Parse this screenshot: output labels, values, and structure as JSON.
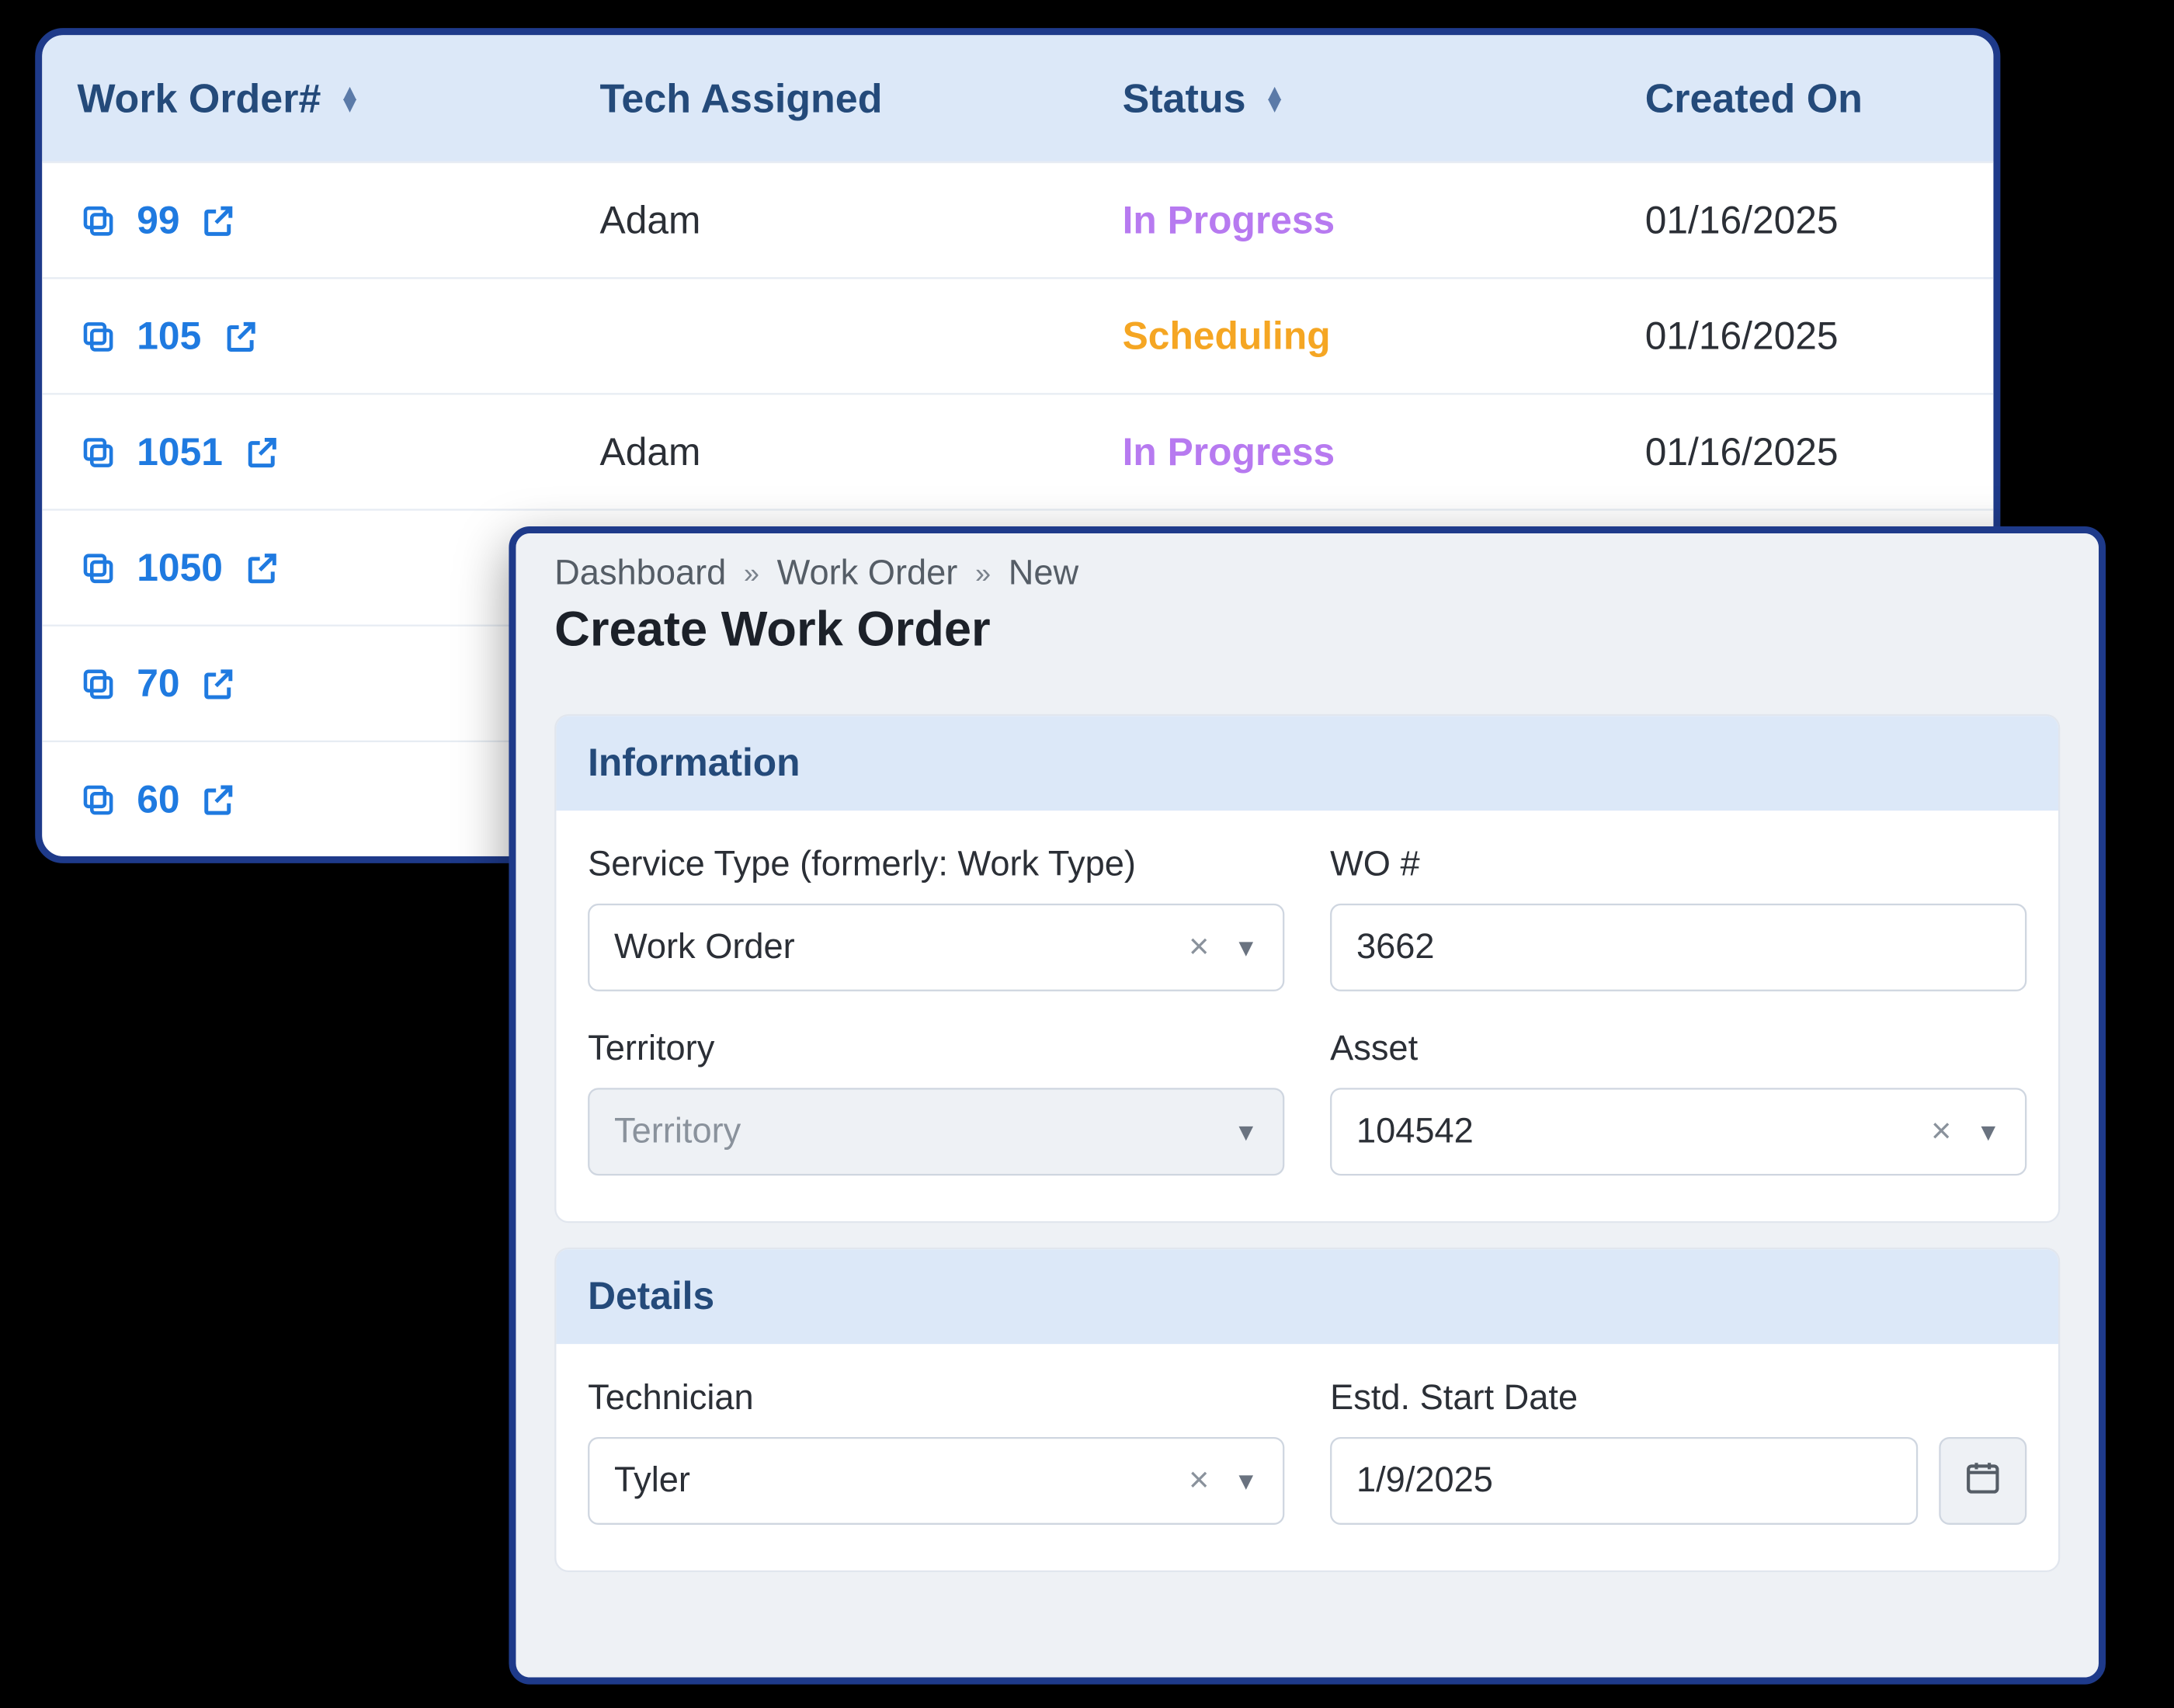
{
  "table": {
    "headers": {
      "work_order": "Work Order#",
      "tech": "Tech Assigned",
      "status": "Status",
      "created": "Created On"
    },
    "rows": [
      {
        "wo": "99",
        "tech": "Adam",
        "status": "In Progress",
        "status_kind": "inprogress",
        "created": "01/16/2025"
      },
      {
        "wo": "105",
        "tech": "",
        "status": "Scheduling",
        "status_kind": "scheduling",
        "created": "01/16/2025"
      },
      {
        "wo": "1051",
        "tech": "Adam",
        "status": "In Progress",
        "status_kind": "inprogress",
        "created": "01/16/2025"
      },
      {
        "wo": "1050",
        "tech": "",
        "status": "",
        "status_kind": "",
        "created": ""
      },
      {
        "wo": "70",
        "tech": "",
        "status": "",
        "status_kind": "",
        "created": ""
      },
      {
        "wo": "60",
        "tech": "",
        "status": "",
        "status_kind": "",
        "created": ""
      }
    ]
  },
  "form": {
    "breadcrumb": [
      "Dashboard",
      "Work Order",
      "New"
    ],
    "title": "Create Work Order",
    "sections": {
      "information": {
        "heading": "Information",
        "service_type_label": "Service Type (formerly: Work Type)",
        "service_type_value": "Work Order",
        "wo_number_label": "WO #",
        "wo_number_value": "3662",
        "territory_label": "Territory",
        "territory_placeholder": "Territory",
        "asset_label": "Asset",
        "asset_value": "104542"
      },
      "details": {
        "heading": "Details",
        "technician_label": "Technician",
        "technician_value": "Tyler",
        "estd_start_label": "Estd. Start Date",
        "estd_start_value": "1/9/2025"
      }
    }
  }
}
